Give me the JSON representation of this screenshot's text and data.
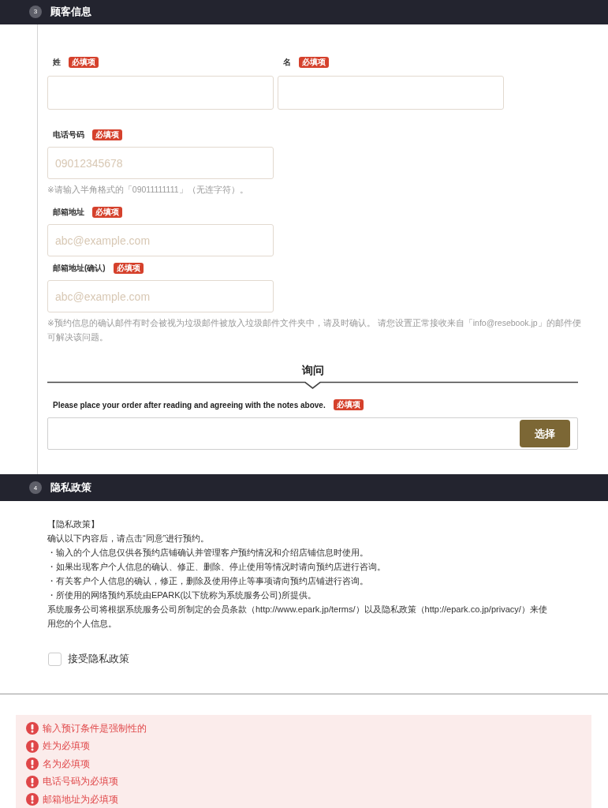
{
  "customer_section": {
    "number": "3",
    "title": "顾客信息",
    "name_fields": [
      {
        "label": "姓",
        "badge": "必填项"
      },
      {
        "label": "名",
        "badge": "必填项"
      }
    ],
    "fields": [
      {
        "label": "电话号码",
        "badge": "必填项",
        "placeholder": "09012345678",
        "hint": "※请输入半角格式的「09011111111」（无连字符）。"
      },
      {
        "label": "邮箱地址",
        "badge": "必填项",
        "placeholder": "abc@example.com"
      },
      {
        "label": "邮箱地址(确认)",
        "badge": "必填项",
        "placeholder": "abc@example.com",
        "hint": "※预约信息的确认邮件有时会被视为垃圾邮件被放入垃圾邮件文件夹中，请及时确认。 请您设置正常接收来自「info@resebook.jp」的邮件便可解决该问题。"
      }
    ],
    "inquiry": {
      "heading": "询问",
      "label": "Please place your order after reading and agreeing with the notes above.",
      "badge": "必填项",
      "button": "选择"
    }
  },
  "privacy_section": {
    "number": "4",
    "title": "隐私政策",
    "paragraphs": [
      "【隐私政策】",
      "确认以下内容后，请点击“同意”进行预约。",
      "・输入的个人信息仅供各预约店铺确认并管理客户预约情况和介绍店铺信息时使用。",
      "・如果出现客户个人信息的确认、修正、删除、停止使用等情况时请向预约店进行咨询。",
      "・有关客户个人信息的确认，修正，删除及使用停止等事项请向预约店铺进行咨询。",
      "・所使用的网络预约系统由EPARK(以下统称为系统服务公司)所提供。",
      "系统服务公司将根据系统服务公司所制定的会员条款（http://www.epark.jp/terms/）以及隐私政策（http://epark.co.jp/privacy/）来使用您的个人信息。"
    ],
    "consent": {
      "label": "接受隐私政策",
      "checked": false
    }
  },
  "errors": [
    "输入预订条件是强制性的",
    "姓为必填项",
    "名为必填项",
    "电话号码为必填项",
    "邮箱地址为必填项"
  ]
}
